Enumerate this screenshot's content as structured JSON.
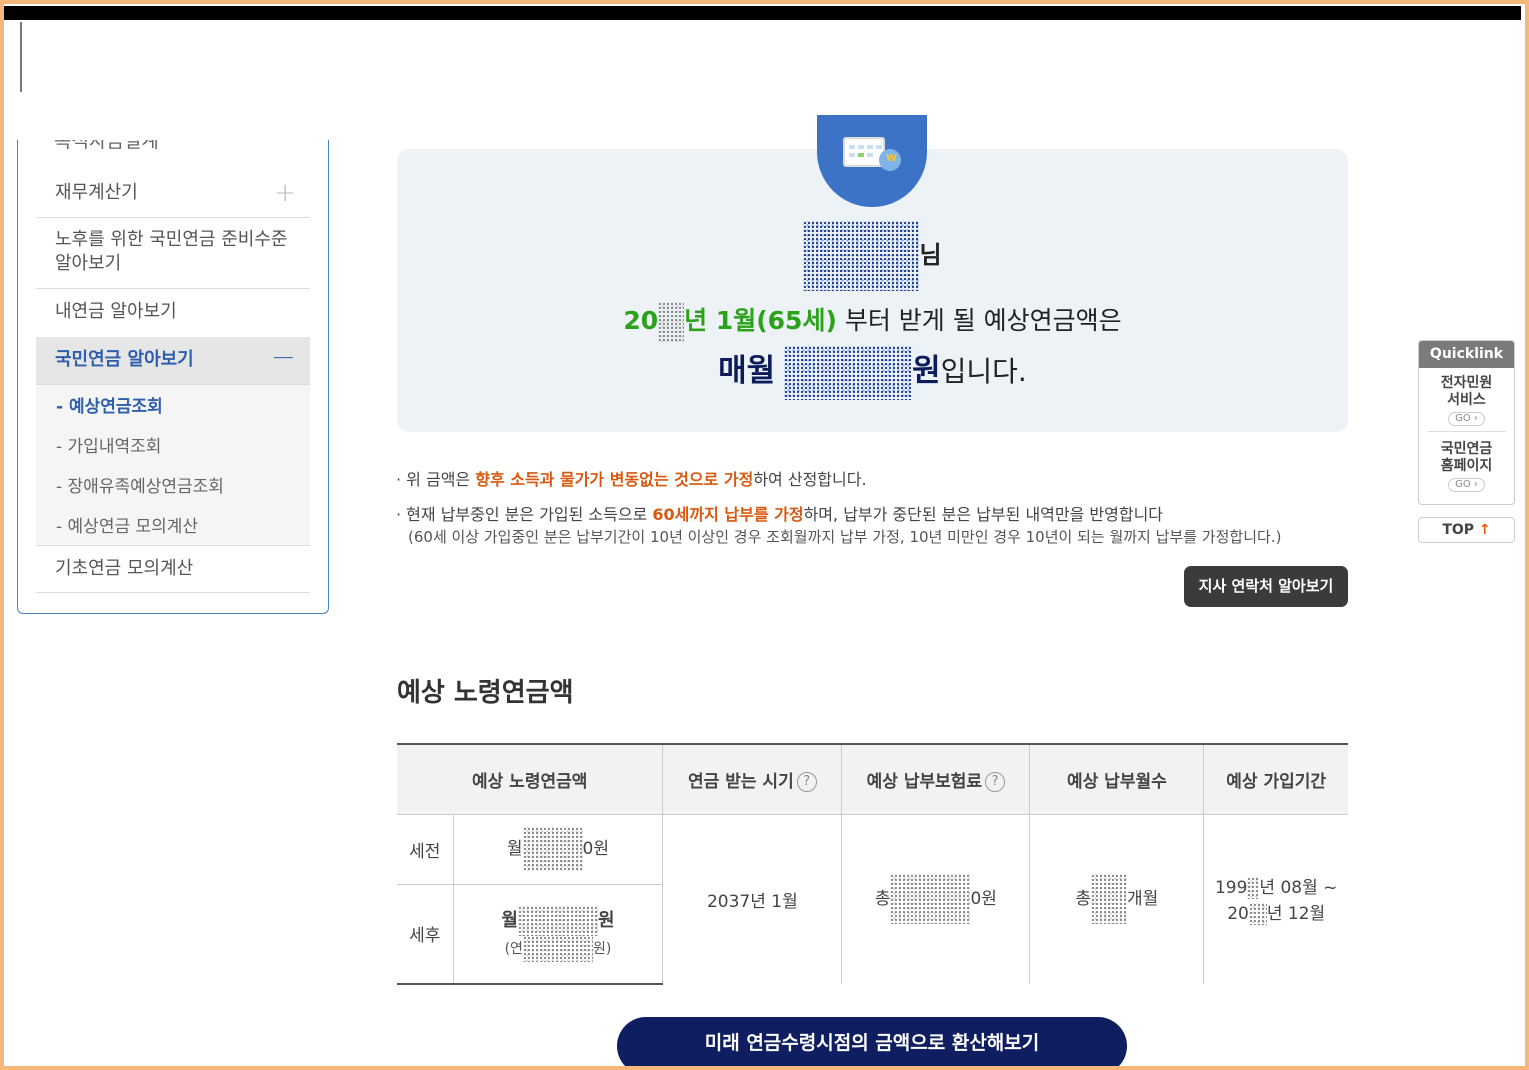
{
  "sidebar": {
    "cut_item": "목적자금설계",
    "items": [
      {
        "label": "재무계산기",
        "toggle": "+"
      },
      {
        "label": "노후를 위한 국민연금 준비수준 알아보기"
      },
      {
        "label": "내연금 알아보기"
      },
      {
        "label": "국민연금 알아보기",
        "toggle": "−"
      },
      {
        "label": "기초연금 모의계산"
      }
    ],
    "sub_items": [
      "- 예상연금조회",
      "- 가입내역조회",
      "- 장애유족예상연금조회",
      "- 예상연금 모의계산"
    ]
  },
  "result": {
    "name_suffix": "님",
    "start_prefix": "20",
    "start_suffix": "년 1월(65세)",
    "start_rest": " 부터 받게 될 예상연금액은",
    "monthly_label": "매월",
    "won": "원",
    "ending": "입니다."
  },
  "notes": {
    "n1_pre": "· 위 금액은 ",
    "n1_hl": "향후 소득과 물가가 변동없는 것으로 가정",
    "n1_post": "하여 산정합니다.",
    "n2_pre": "· 현재 납부중인 분은 가입된 소득으로 ",
    "n2_hl": "60세까지 납부를 가정",
    "n2_post": "하며, 납부가 중단된 분은 납부된 내역만을 반영합니다",
    "n2_sub": "(60세 이상 가입중인 분은 납부기간이 10년 이상인 경우 조회월까지 납부 가정, 10년 미만인 경우 10년이 되는 월까지 납부를 가정합니다.)"
  },
  "branch_button": "지사 연락처 알아보기",
  "section_title": "예상 노령연금액",
  "table": {
    "headers": [
      "예상 노령연금액",
      "연금 받는 시기",
      "예상 납부보험료",
      "예상 납부월수",
      "예상 가입기간"
    ],
    "help": "?",
    "row_pre_tax": "세전",
    "row_after_tax": "세후",
    "pre_tax_pre": "월",
    "pre_tax_post": "0원",
    "after_tax_pre": "월",
    "after_tax_post": "원",
    "after_tax_sub_pre": "(연",
    "after_tax_sub_post": "원)",
    "receive_time": "2037년 1월",
    "premium_pre": "총",
    "premium_post": "0원",
    "months_pre": "총",
    "months_post": "개월",
    "period_line1_pre": "199",
    "period_line1_post": "년 08월 ~",
    "period_line2_pre": "20",
    "period_line2_post": "년 12월"
  },
  "convert_button": "미래 연금수령시점의 금액으로 환산해보기",
  "quicklink": {
    "title": "Quicklink",
    "item1": [
      "전자민원",
      "서비스"
    ],
    "item2": [
      "국민연금",
      "홈페이지"
    ],
    "go": "GO ›",
    "top": "TOP",
    "top_arrow": "↑"
  }
}
